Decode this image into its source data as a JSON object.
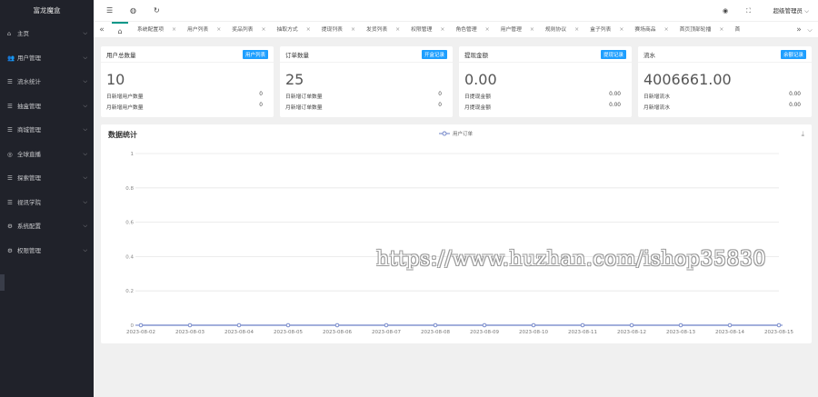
{
  "app": {
    "title": "富龙魔盒"
  },
  "sidebar": {
    "items": [
      {
        "label": "主页",
        "icon": "home-icon",
        "glyph": "⌂"
      },
      {
        "label": "用户管理",
        "icon": "users-icon",
        "glyph": "👥"
      },
      {
        "label": "流水统计",
        "icon": "list-icon",
        "glyph": "☰"
      },
      {
        "label": "抽盒管理",
        "icon": "list-icon",
        "glyph": "☰"
      },
      {
        "label": "商城管理",
        "icon": "list-icon",
        "glyph": "☰"
      },
      {
        "label": "全球直播",
        "icon": "globe-icon",
        "glyph": "◎"
      },
      {
        "label": "探索管理",
        "icon": "list-icon",
        "glyph": "☰"
      },
      {
        "label": "视讯学院",
        "icon": "list-icon",
        "glyph": "☰"
      },
      {
        "label": "系统配置",
        "icon": "settings-icon",
        "glyph": "⚙"
      },
      {
        "label": "权限管理",
        "icon": "gear-icon",
        "glyph": "⚙"
      }
    ]
  },
  "header": {
    "menu_glyph": "☰",
    "globe_glyph": "◍",
    "refresh_glyph": "↻",
    "eye_glyph": "◉",
    "fullscreen_glyph": "⛶",
    "user_label": "超级管理员"
  },
  "tabs": {
    "home_glyph": "⌂",
    "items": [
      "系统配置项",
      "用户列表",
      "奖品列表",
      "抽取方式",
      "提现列表",
      "发货列表",
      "权限管理",
      "角色管理",
      "用户管理",
      "规则协议",
      "盒子列表",
      "赛场商品",
      "首页顶部轮播",
      "首"
    ]
  },
  "cards": [
    {
      "title": "用户总数量",
      "badge": "用户列表",
      "value": "10",
      "rows": [
        {
          "label": "日新增用户数量",
          "value": "0"
        },
        {
          "label": "月新增用户数量",
          "value": "0"
        }
      ]
    },
    {
      "title": "订单数量",
      "badge": "开盒记录",
      "value": "25",
      "rows": [
        {
          "label": "日新增订单数量",
          "value": "0"
        },
        {
          "label": "月新增订单数量",
          "value": "0"
        }
      ]
    },
    {
      "title": "提现金额",
      "badge": "提现记录",
      "value": "0.00",
      "rows": [
        {
          "label": "日提现金额",
          "value": "0.00"
        },
        {
          "label": "月提现金额",
          "value": "0.00"
        }
      ]
    },
    {
      "title": "流水",
      "badge": "余额记录",
      "value": "4006661.00",
      "rows": [
        {
          "label": "日新增流水",
          "value": "0.00"
        },
        {
          "label": "月新增流水",
          "value": "0.00"
        }
      ]
    }
  ],
  "chart_panel": {
    "title": "数据统计",
    "download_glyph": "⤓"
  },
  "chart_data": {
    "type": "line",
    "title": "数据统计",
    "legend": "top-center",
    "x": [
      "2023-08-02",
      "2023-08-03",
      "2023-08-04",
      "2023-08-05",
      "2023-08-06",
      "2023-08-07",
      "2023-08-08",
      "2023-08-09",
      "2023-08-10",
      "2023-08-11",
      "2023-08-12",
      "2023-08-13",
      "2023-08-14",
      "2023-08-15"
    ],
    "series": [
      {
        "name": "用户订单",
        "values": [
          0,
          0,
          0,
          0,
          0,
          0,
          0,
          0,
          0,
          0,
          0,
          0,
          0,
          0
        ],
        "color": "#6b7fc6"
      }
    ],
    "yticks": [
      "0",
      "0.2",
      "0.4",
      "0.6",
      "0.8",
      "1"
    ],
    "ylim": [
      0,
      1
    ],
    "grid": true
  },
  "watermark": "https://www.huzhan.com/ishop35830"
}
